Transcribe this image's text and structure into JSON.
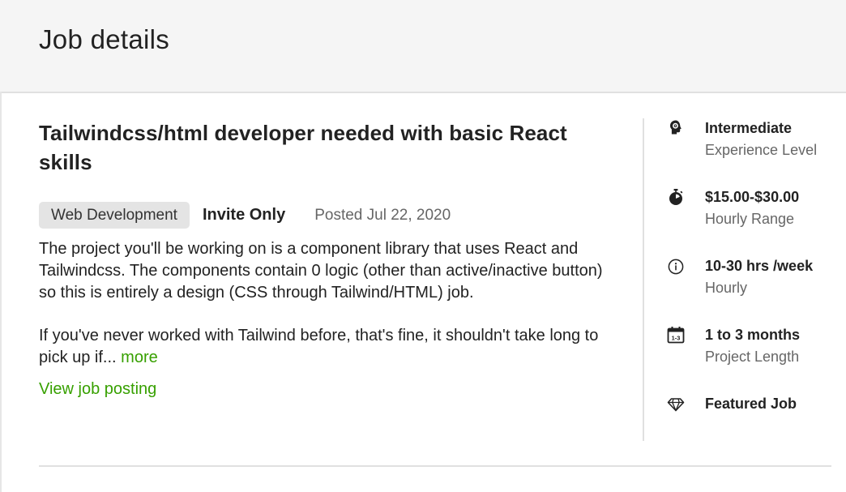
{
  "page": {
    "title": "Job details"
  },
  "job": {
    "title": "Tailwindcss/html developer needed with basic React skills",
    "category": "Web Development",
    "visibility": "Invite Only",
    "posted": "Posted Jul 22, 2020",
    "description_p1": "The project you'll be working on is a component library that uses React and Tailwindcss. The components contain 0 logic (other than active/inactive button) so this is entirely a design (CSS through Tailwind/HTML) job.",
    "description_p2": "If you've never worked with Tailwind before, that's fine, it shouldn't take long to pick up if...",
    "more_label": "more",
    "view_posting_label": "View job posting"
  },
  "sidebar": {
    "items": [
      {
        "icon": "experience-level-icon",
        "value": "Intermediate",
        "label": "Experience Level"
      },
      {
        "icon": "stopwatch-icon",
        "value": "$15.00-$30.00",
        "label": "Hourly Range"
      },
      {
        "icon": "info-clock-icon",
        "value": "10-30 hrs /week",
        "label": "Hourly"
      },
      {
        "icon": "calendar-icon",
        "value": "1 to 3 months",
        "label": "Project Length",
        "icon_text": "1-3"
      },
      {
        "icon": "diamond-icon",
        "value": "Featured Job",
        "label": ""
      }
    ]
  },
  "colors": {
    "accent_green": "#37a000",
    "header_bg": "#f5f5f5",
    "badge_bg": "#e4e4e4"
  }
}
